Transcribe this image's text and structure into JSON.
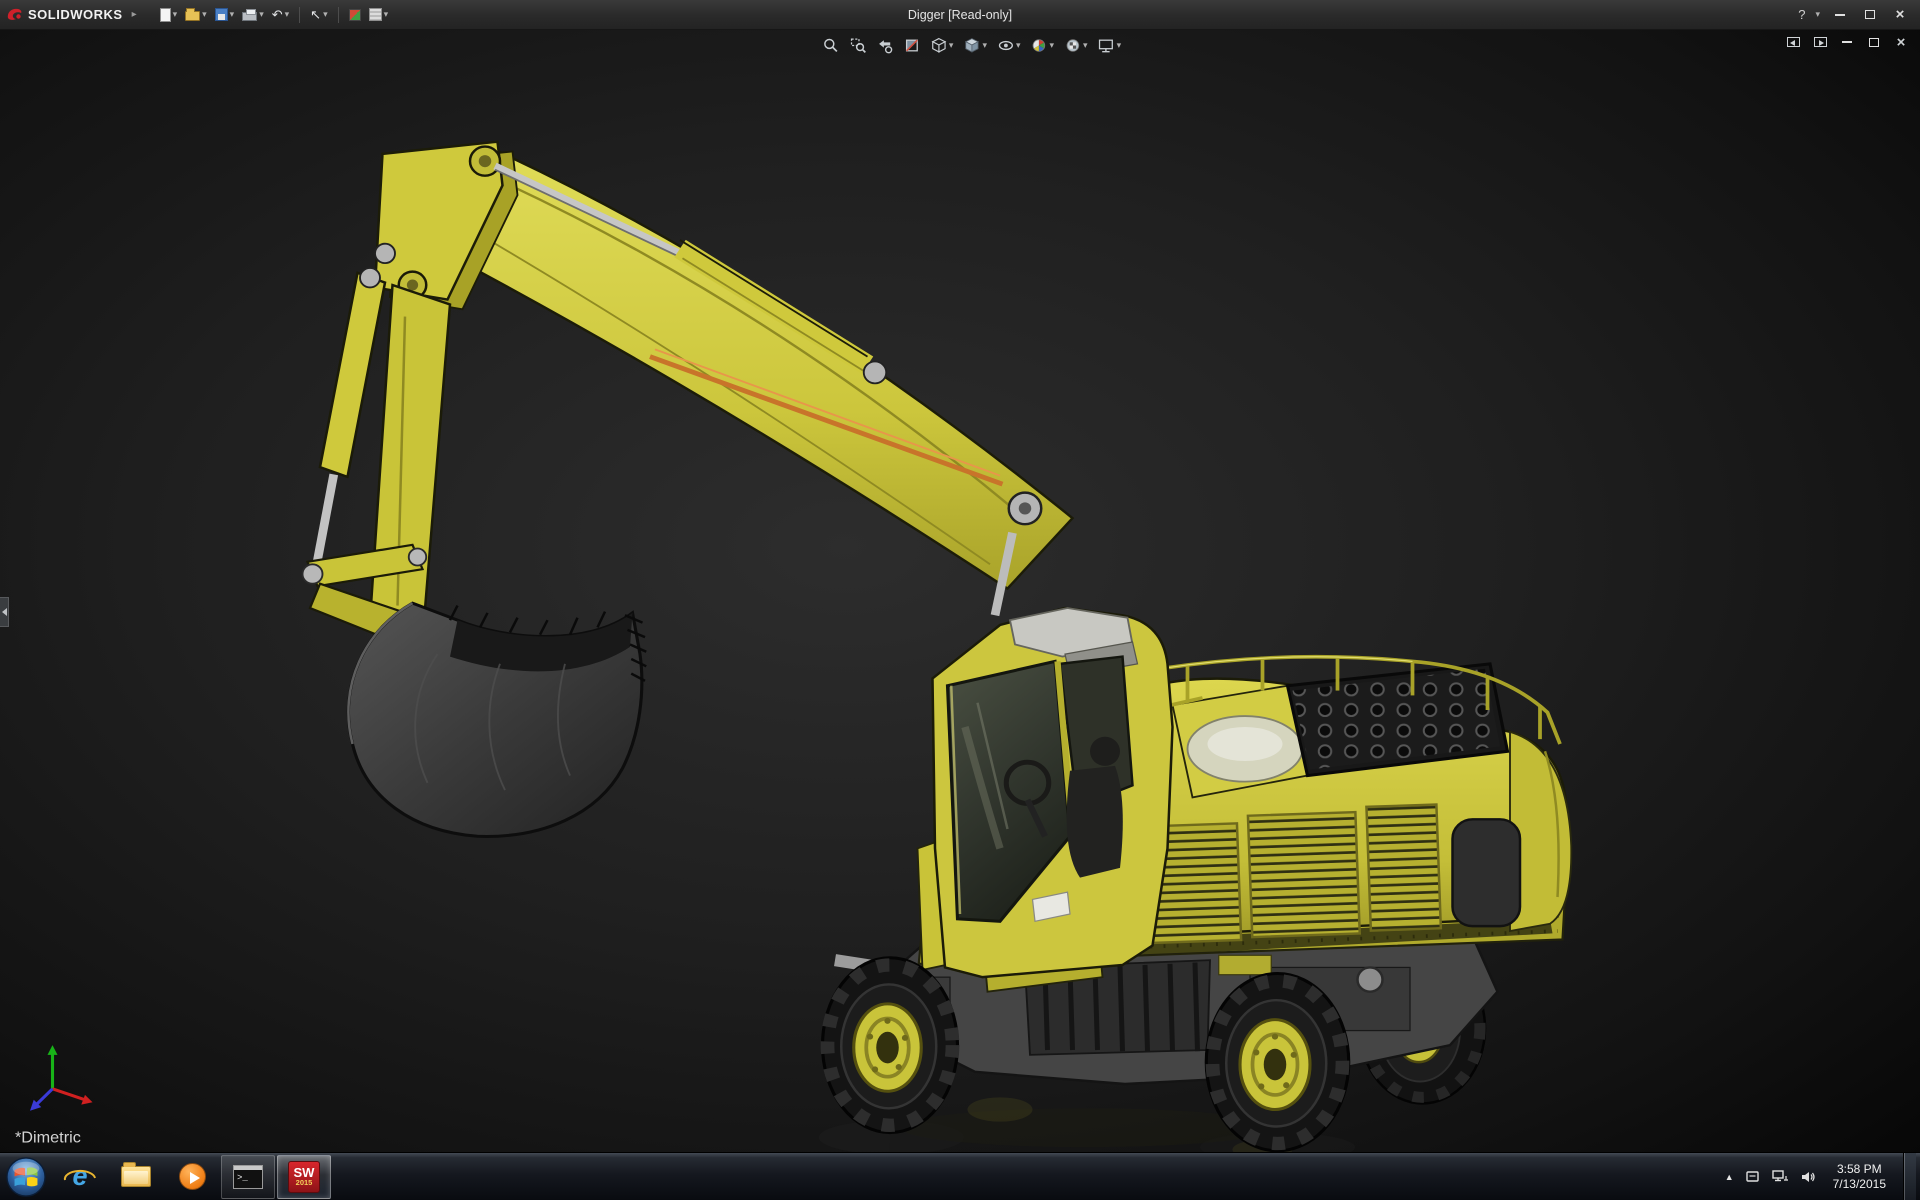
{
  "window": {
    "brand": "SOLIDWORKS",
    "title": "Digger [Read-only]"
  },
  "glyphs": {
    "caret": "▾",
    "menu_expand": "▸",
    "undo": "↶",
    "select": "↖",
    "help": "?",
    "close": "×",
    "tray_expand": "▲",
    "console_prompt": ">_"
  },
  "title_toolbar": {
    "items": [
      {
        "name": "new-document",
        "caret": true
      },
      {
        "name": "open-document",
        "caret": true
      },
      {
        "name": "save",
        "caret": true
      },
      {
        "name": "print",
        "caret": true
      },
      {
        "name": "undo",
        "caret": true
      },
      {
        "name": "select",
        "caret": true
      },
      {
        "name": "xpress-products",
        "caret": false
      },
      {
        "name": "sheet-properties",
        "caret": true
      }
    ]
  },
  "headsup_toolbar": {
    "items": [
      {
        "name": "zoom-to-fit"
      },
      {
        "name": "zoom-to-area"
      },
      {
        "name": "previous-view"
      },
      {
        "name": "section-view"
      },
      {
        "name": "view-orientation",
        "caret": true
      },
      {
        "name": "display-style",
        "caret": true
      },
      {
        "name": "hide-show-items",
        "caret": true
      },
      {
        "name": "edit-appearance",
        "caret": true
      },
      {
        "name": "apply-scene",
        "caret": true
      },
      {
        "name": "view-settings",
        "caret": true
      }
    ]
  },
  "viewport": {
    "orientation_label": "*Dimetric",
    "model_name": "Digger excavator 3D model",
    "background": "#161616"
  },
  "document_controls": {
    "items": [
      {
        "name": "pane-left"
      },
      {
        "name": "pane-right"
      },
      {
        "name": "minimize-document"
      },
      {
        "name": "restore-document"
      },
      {
        "name": "close-document"
      }
    ]
  },
  "taskbar": {
    "ie_glyph": "e",
    "sw_label": "SW",
    "sw_year": "2015",
    "clock": {
      "time": "3:58 PM",
      "date": "7/13/2015"
    },
    "apps": [
      {
        "name": "internet-explorer",
        "state": "pinned"
      },
      {
        "name": "file-explorer",
        "state": "pinned"
      },
      {
        "name": "media-player",
        "state": "pinned"
      },
      {
        "name": "command-prompt",
        "state": "open"
      },
      {
        "name": "solidworks-2015",
        "state": "active"
      }
    ]
  },
  "colors": {
    "excavator_yellow": "#d2cc40",
    "excavator_yellow_dark": "#aaa42a",
    "brand_red": "#d0202a",
    "titlebar": "#2e2e2e",
    "viewport_bg": "#161616",
    "glass": "#3d4237",
    "metal_gray": "#c2c2c2",
    "bucket_gray": "#3c3c3c"
  }
}
